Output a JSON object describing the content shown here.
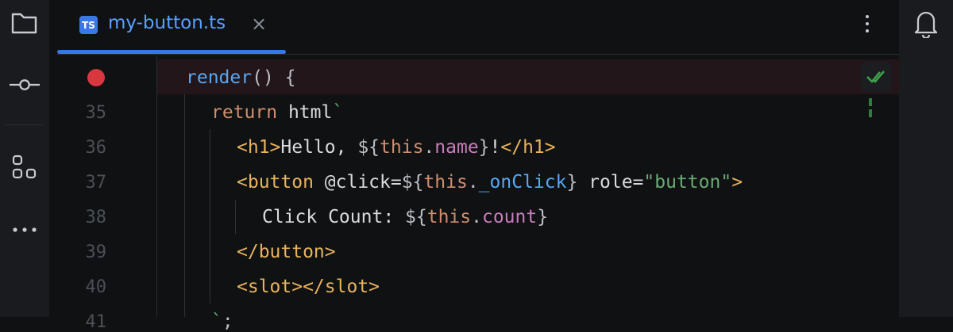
{
  "sidebar": {
    "icons": [
      "folder-icon",
      "commit-icon",
      "structure-icon",
      "more-icon"
    ]
  },
  "notifications": {
    "icon": "bell-icon"
  },
  "tab": {
    "badge": "TS",
    "title": "my-button.ts",
    "close": "×"
  },
  "colors": {
    "tab_accent": "#3578e5",
    "breakpoint": "#d8373f",
    "ok_check": "#3fa04a"
  },
  "editor": {
    "breakpoint_line": "render() {",
    "line_numbers": [
      "35",
      "36",
      "37",
      "38",
      "39",
      "40",
      "41"
    ],
    "lines": [
      {
        "tokens": [
          [
            "kw-fn",
            "render"
          ],
          [
            "punc",
            "() {"
          ]
        ]
      },
      {
        "tokens": [
          [
            "kw",
            "return"
          ],
          [
            "plain",
            " html"
          ],
          [
            "str",
            "`"
          ]
        ]
      },
      {
        "tokens": [
          [
            "tag",
            "<h1>"
          ],
          [
            "plain",
            "Hello, "
          ],
          [
            "punc",
            "${"
          ],
          [
            "this",
            "this"
          ],
          [
            "punc",
            "."
          ],
          [
            "prop",
            "name"
          ],
          [
            "punc",
            "}"
          ],
          [
            "plain",
            "!"
          ],
          [
            "tag",
            "</h1>"
          ]
        ]
      },
      {
        "tokens": [
          [
            "tag",
            "<button"
          ],
          [
            "plain",
            " @click="
          ],
          [
            "punc",
            "${"
          ],
          [
            "this",
            "this"
          ],
          [
            "punc",
            "."
          ],
          [
            "method",
            "_onClick"
          ],
          [
            "punc",
            "}"
          ],
          [
            "plain",
            " role="
          ],
          [
            "str",
            "\"button\""
          ],
          [
            "tag",
            ">"
          ]
        ]
      },
      {
        "tokens": [
          [
            "plain",
            "Click Count: "
          ],
          [
            "punc",
            "${"
          ],
          [
            "this",
            "this"
          ],
          [
            "punc",
            "."
          ],
          [
            "prop",
            "count"
          ],
          [
            "punc",
            "}"
          ]
        ]
      },
      {
        "tokens": [
          [
            "tag",
            "</button>"
          ]
        ]
      },
      {
        "tokens": [
          [
            "tag",
            "<slot></slot>"
          ]
        ]
      },
      {
        "tokens": [
          [
            "str",
            "`"
          ],
          [
            "punc",
            ";"
          ]
        ]
      }
    ]
  }
}
